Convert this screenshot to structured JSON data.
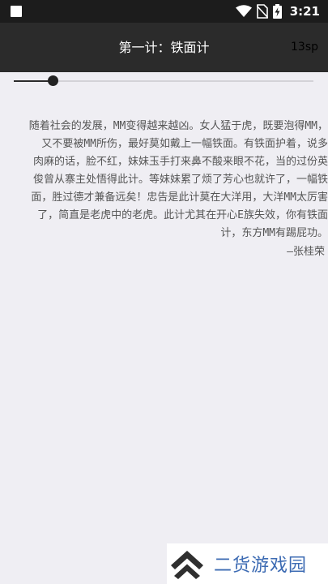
{
  "status_bar": {
    "time": "3:21",
    "icons": [
      "notification-square-icon",
      "wifi-icon",
      "no-sim-icon",
      "battery-charging-icon"
    ]
  },
  "app_bar": {
    "title": "第一计：铁面计",
    "font_size_label": "13sp"
  },
  "font_slider": {
    "level": 0.13
  },
  "article": {
    "lines": [
      "随着社会的发展，MM变得越来越凶。女人猛于虎，既要泡得MM，",
      "又不要被MM所伤，最好莫如戴上一幅铁面。有铁面护着，说多",
      "肉麻的话，脸不红，妹妹玉手打来鼻不酸来眼不花，当的过份英",
      "俊曾从寨主处悟得此计。等妹妹累了烦了芳心也就许了，一幅铁",
      "面，胜过德才兼备远矣！忠告是此计莫在大洋用，大洋MM太厉害",
      "了，简直是老虎中的老虎。此计尤其在开心E族失效，你有铁面",
      "计，东方MM有踢屁功。"
    ],
    "signature": "—张桂荣"
  },
  "watermark": {
    "text": "二货游戏园",
    "icon": "double-chevron-up-logo-icon"
  },
  "colors": {
    "background": "#efeef3",
    "app_bar": "#2b2b2b",
    "status_bar": "#1c1c1c",
    "text": "#555555",
    "watermark_text": "#3d6bb3"
  }
}
